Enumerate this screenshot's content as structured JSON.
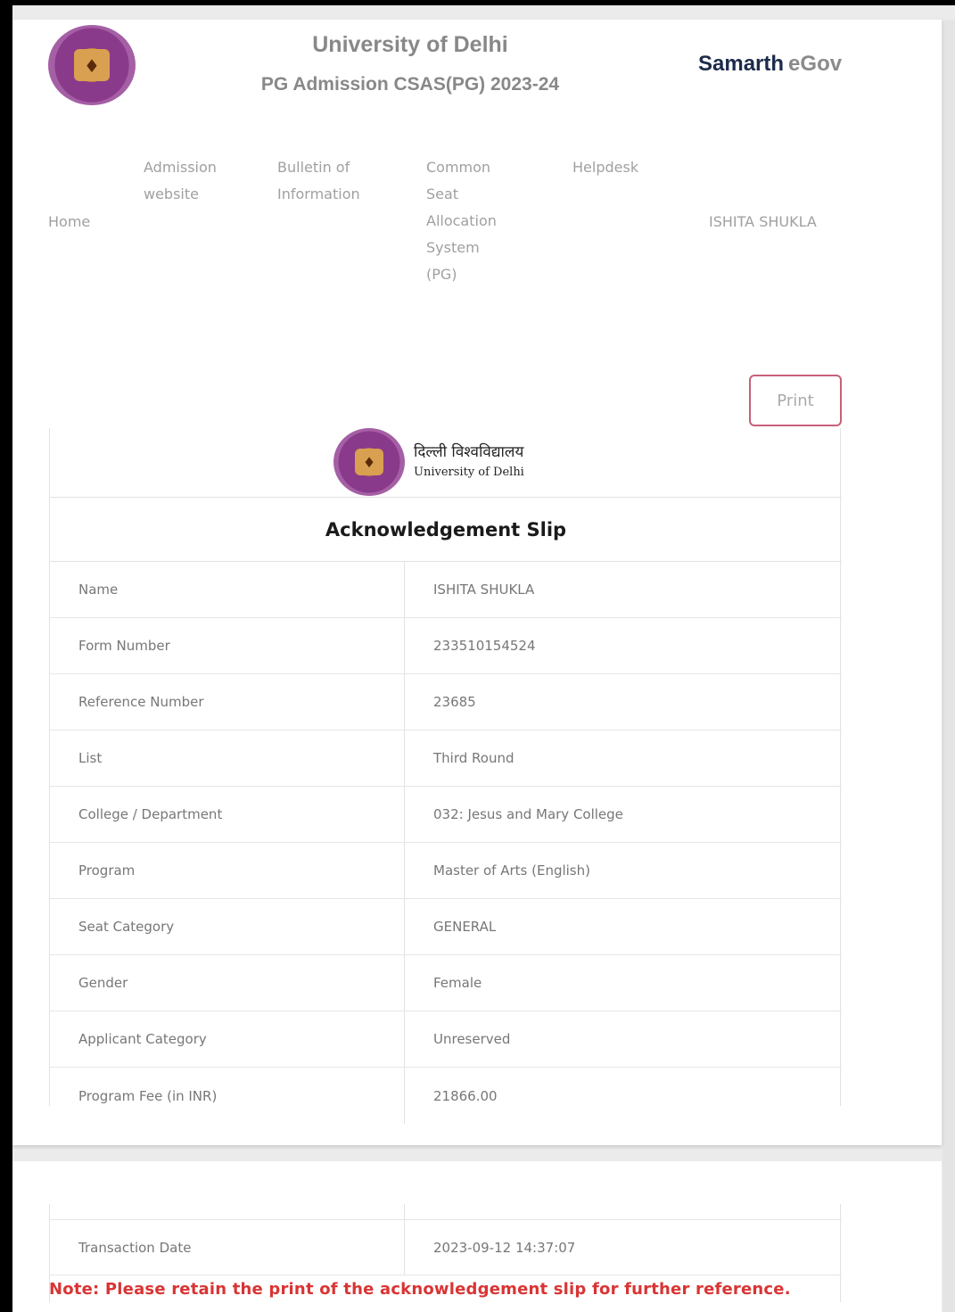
{
  "header": {
    "university": "University of Delhi",
    "subtitle": "PG Admission CSAS(PG) 2023-24",
    "brand_main": "Samarth",
    "brand_sub": "eGov"
  },
  "nav": {
    "home": "Home",
    "admission_website": [
      "Admission",
      "website"
    ],
    "bulletin": [
      "Bulletin of",
      "Information"
    ],
    "csas": [
      "Common",
      "Seat",
      "Allocation",
      "System",
      "(PG)"
    ],
    "helpdesk": "Helpdesk",
    "user": "ISHITA SHUKLA"
  },
  "print_label": "Print",
  "slip": {
    "hindi_name": "दिल्ली विश्वविद्यालय",
    "english_name": "University of Delhi",
    "title": "Acknowledgement Slip",
    "rows": [
      {
        "label": "Name",
        "value": "ISHITA SHUKLA"
      },
      {
        "label": "Form Number",
        "value": "233510154524"
      },
      {
        "label": "Reference Number",
        "value": "23685"
      },
      {
        "label": "List",
        "value": "Third Round"
      },
      {
        "label": "College / Department",
        "value": "032: Jesus and Mary College"
      },
      {
        "label": "Program",
        "value": "Master of Arts (English)"
      },
      {
        "label": "Seat Category",
        "value": "GENERAL"
      },
      {
        "label": "Gender",
        "value": "Female"
      },
      {
        "label": "Applicant Category",
        "value": "Unreserved"
      },
      {
        "label": "Program Fee (in INR)",
        "value": "21866.00"
      }
    ],
    "transaction": {
      "label": "Transaction Date",
      "value": "2023-09-12 14:37:07"
    }
  },
  "note": "Note: Please retain the print of the acknowledgement slip for further reference."
}
